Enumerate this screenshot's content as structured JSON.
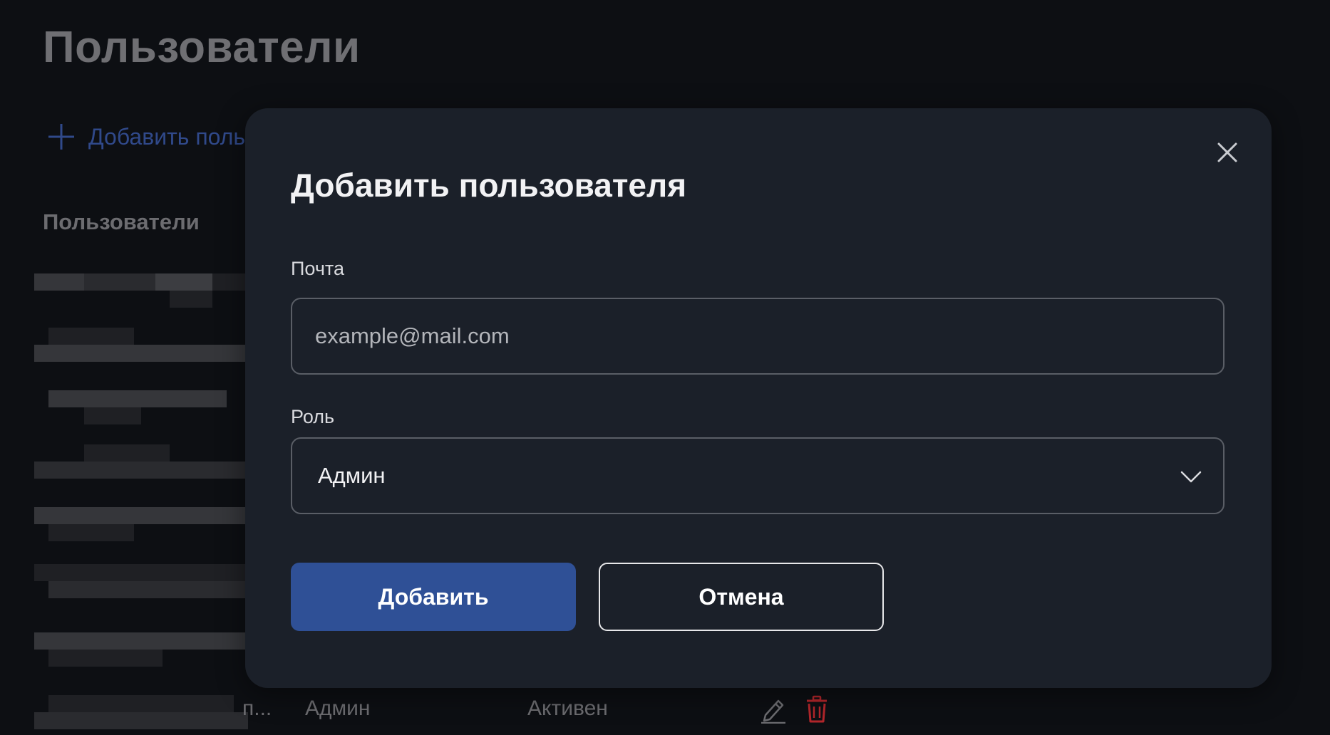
{
  "page": {
    "title": "Пользователи",
    "add_user_link": "Добавить поль",
    "section_title": "Пользователи",
    "visible_row": {
      "name_truncated": "п...",
      "role": "Админ",
      "status": "Активен"
    }
  },
  "modal": {
    "title": "Добавить пользователя",
    "email": {
      "label": "Почта",
      "value": "",
      "placeholder": "example@mail.com"
    },
    "role": {
      "label": "Роль",
      "selected": "Админ"
    },
    "buttons": {
      "submit": "Добавить",
      "cancel": "Отмена"
    }
  },
  "colors": {
    "background": "#0d0f13",
    "modal_bg": "#1b2029",
    "primary_button": "#2f5096",
    "link": "#30498a",
    "delete_icon": "#b3262b"
  },
  "icons": [
    "plus-icon",
    "close-icon",
    "chevron-down-icon",
    "edit-icon",
    "trash-icon"
  ]
}
